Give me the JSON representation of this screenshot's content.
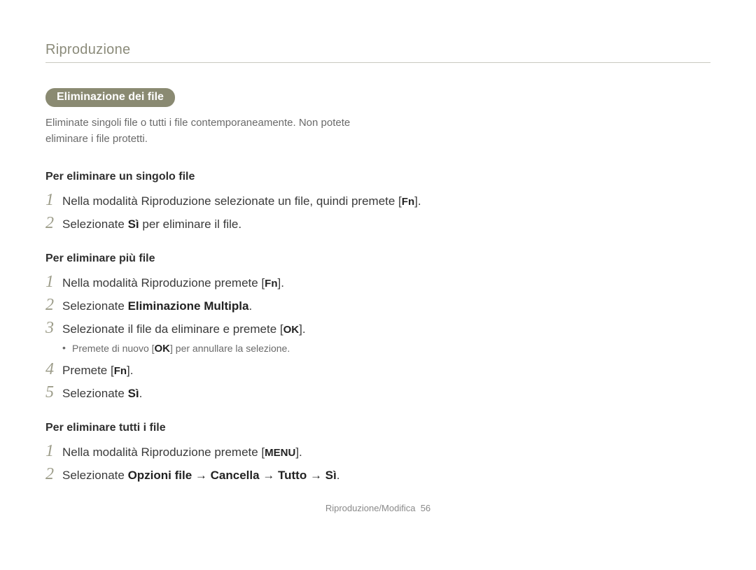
{
  "breadcrumb": "Riproduzione",
  "section_title": "Eliminazione dei file",
  "intro": "Eliminate singoli file o tutti i file contemporaneamente. Non potete eliminare i file protetti.",
  "sub1": {
    "title": "Per eliminare un singolo file",
    "steps": {
      "s1_a": "Nella modalità Riproduzione selezionate un file, quindi premete [",
      "s1_key": "Fn",
      "s1_b": "].",
      "s2_a": "Selezionate ",
      "s2_b": "Sì",
      "s2_c": " per eliminare il file."
    }
  },
  "sub2": {
    "title": "Per eliminare più file",
    "steps": {
      "s1_a": "Nella modalità Riproduzione premete [",
      "s1_key": "Fn",
      "s1_b": "].",
      "s2_a": "Selezionate ",
      "s2_b": "Eliminazione Multipla",
      "s2_c": ".",
      "s3_a": "Selezionate il file da eliminare e premete [",
      "s3_key": "OK",
      "s3_b": "].",
      "s3_sub_a": "Premete di nuovo [",
      "s3_sub_key": "OK",
      "s3_sub_b": "] per annullare la selezione.",
      "s4_a": "Premete [",
      "s4_key": "Fn",
      "s4_b": "].",
      "s5_a": "Selezionate ",
      "s5_b": "Sì",
      "s5_c": "."
    }
  },
  "sub3": {
    "title": "Per eliminare tutti i file",
    "steps": {
      "s1_a": "Nella modalità Riproduzione premete [",
      "s1_key": "MENU",
      "s1_b": "].",
      "s2_a": "Selezionate ",
      "s2_b": "Opzioni file → Cancella → Tutto → Sì",
      "s2_c": "."
    }
  },
  "footer_label": "Riproduzione/Modifica",
  "footer_page": "56",
  "nums": {
    "n1": "1",
    "n2": "2",
    "n3": "3",
    "n4": "4",
    "n5": "5"
  }
}
